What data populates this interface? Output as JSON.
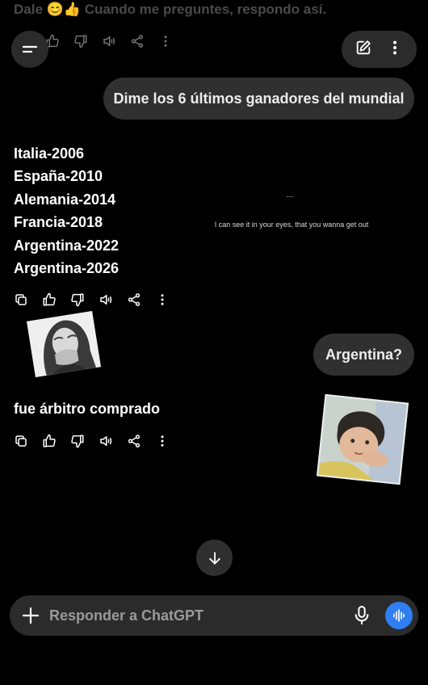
{
  "faded_top_text": "Dale 😊👍 Cuando me preguntes, respondo así.",
  "messages": {
    "user_1": "Dime los 6 últimos ganadores del mundial",
    "answer_1": [
      "Italia-2006",
      "España-2010",
      "Alemania-2014",
      "Francia-2018",
      "Argentina-2022",
      "Argentina-2026"
    ],
    "user_2": "Argentina?",
    "answer_2": "fue árbitro comprado"
  },
  "overlay": {
    "dots": "...",
    "caption": "I can see it in your eyes, that you wanna get out"
  },
  "composer": {
    "placeholder": "Responder a ChatGPT"
  },
  "icons": {
    "menu": "menu-icon",
    "new_chat": "edit-icon",
    "more": "more-vertical-icon",
    "copy": "copy-icon",
    "thumbs_up": "thumbs-up-icon",
    "thumbs_down": "thumbs-down-icon",
    "read_aloud": "speaker-icon",
    "share": "share-icon",
    "scroll_down": "arrow-down-icon",
    "add": "plus-icon",
    "mic": "mic-icon",
    "voice": "voice-waveform-icon"
  },
  "colors": {
    "background": "#000000",
    "bubble": "#303030",
    "voice_button": "#2f7ef2"
  }
}
